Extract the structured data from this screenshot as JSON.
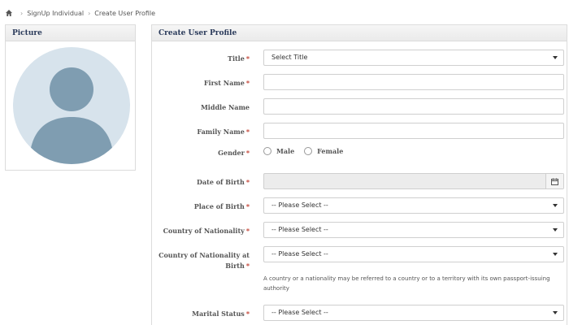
{
  "breadcrumb": {
    "home_icon": "home-icon",
    "items": [
      "SignUp Individual",
      "Create User Profile"
    ]
  },
  "picture_panel": {
    "title": "Picture",
    "avatar_icon": "user-avatar-icon"
  },
  "form": {
    "title": "Create User Profile",
    "title_field": {
      "label": "Title",
      "required": "*",
      "value": "Select Title"
    },
    "first_name": {
      "label": "First Name",
      "required": "*",
      "value": ""
    },
    "middle_name": {
      "label": "Middle Name",
      "value": ""
    },
    "family_name": {
      "label": "Family Name",
      "required": "*",
      "value": ""
    },
    "gender": {
      "label": "Gender",
      "required": "*",
      "options": [
        "Male",
        "Female"
      ]
    },
    "date_of_birth": {
      "label": "Date of Birth",
      "required": "*",
      "value": "",
      "icon": "calendar-icon"
    },
    "place_of_birth": {
      "label": "Place of Birth",
      "required": "*",
      "value": "-- Please Select --"
    },
    "country_nationality": {
      "label": "Country of Nationality",
      "required": "*",
      "value": "-- Please Select --"
    },
    "country_nationality_birth": {
      "label": "Country of Nationality at Birth",
      "required": "*",
      "value": "-- Please Select --"
    },
    "nationality_hint": "A country or a nationality may be referred to a country or to a territory with its own passport-issuing authority",
    "marital_status": {
      "label": "Marital Status",
      "required": "*",
      "value": "-- Please Select --"
    }
  },
  "colors": {
    "required": "#c0392b",
    "avatar_bg": "#d7e3ec",
    "avatar_fg": "#7f9db1",
    "heading": "#2a3a5a"
  }
}
